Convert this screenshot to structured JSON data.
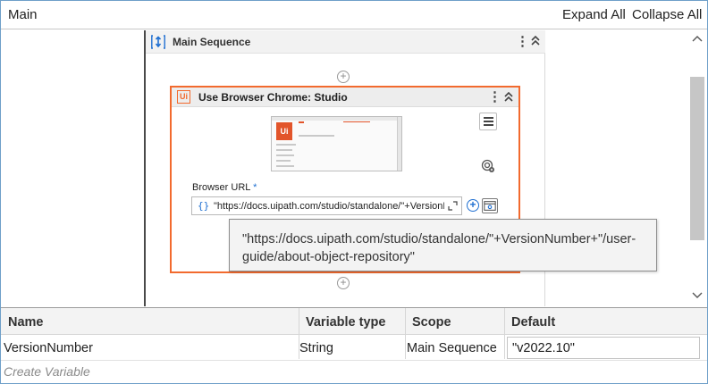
{
  "header": {
    "title": "Main",
    "expand_all": "Expand All",
    "collapse_all": "Collapse All"
  },
  "sequence": {
    "title": "Main Sequence",
    "icon": "sequence-icon"
  },
  "activity": {
    "title": "Use Browser Chrome: Studio",
    "logo_text": "Ui",
    "thumbnail_logo": "Ui",
    "url_label": "Browser URL",
    "required_marker": "*",
    "url_braces": "{}",
    "url_value": "\"https://docs.uipath.com/studio/standalone/\"+VersionNumber+\"/user-guide/about-object-repository\"",
    "border_color": "#f26a2e"
  },
  "tooltip": {
    "text": "\"https://docs.uipath.com/studio/standalone/\"+VersionNumber+\"/user-guide/about-object-repository\""
  },
  "variables": {
    "columns": [
      "Name",
      "Variable type",
      "Scope",
      "Default"
    ],
    "rows": [
      {
        "name": "VersionNumber",
        "type": "String",
        "scope": "Main Sequence",
        "default": "\"v2022.10\""
      }
    ],
    "create_label": "Create Variable"
  },
  "colors": {
    "accent_blue": "#1f6fd1",
    "uipath_orange": "#f26a2e"
  }
}
